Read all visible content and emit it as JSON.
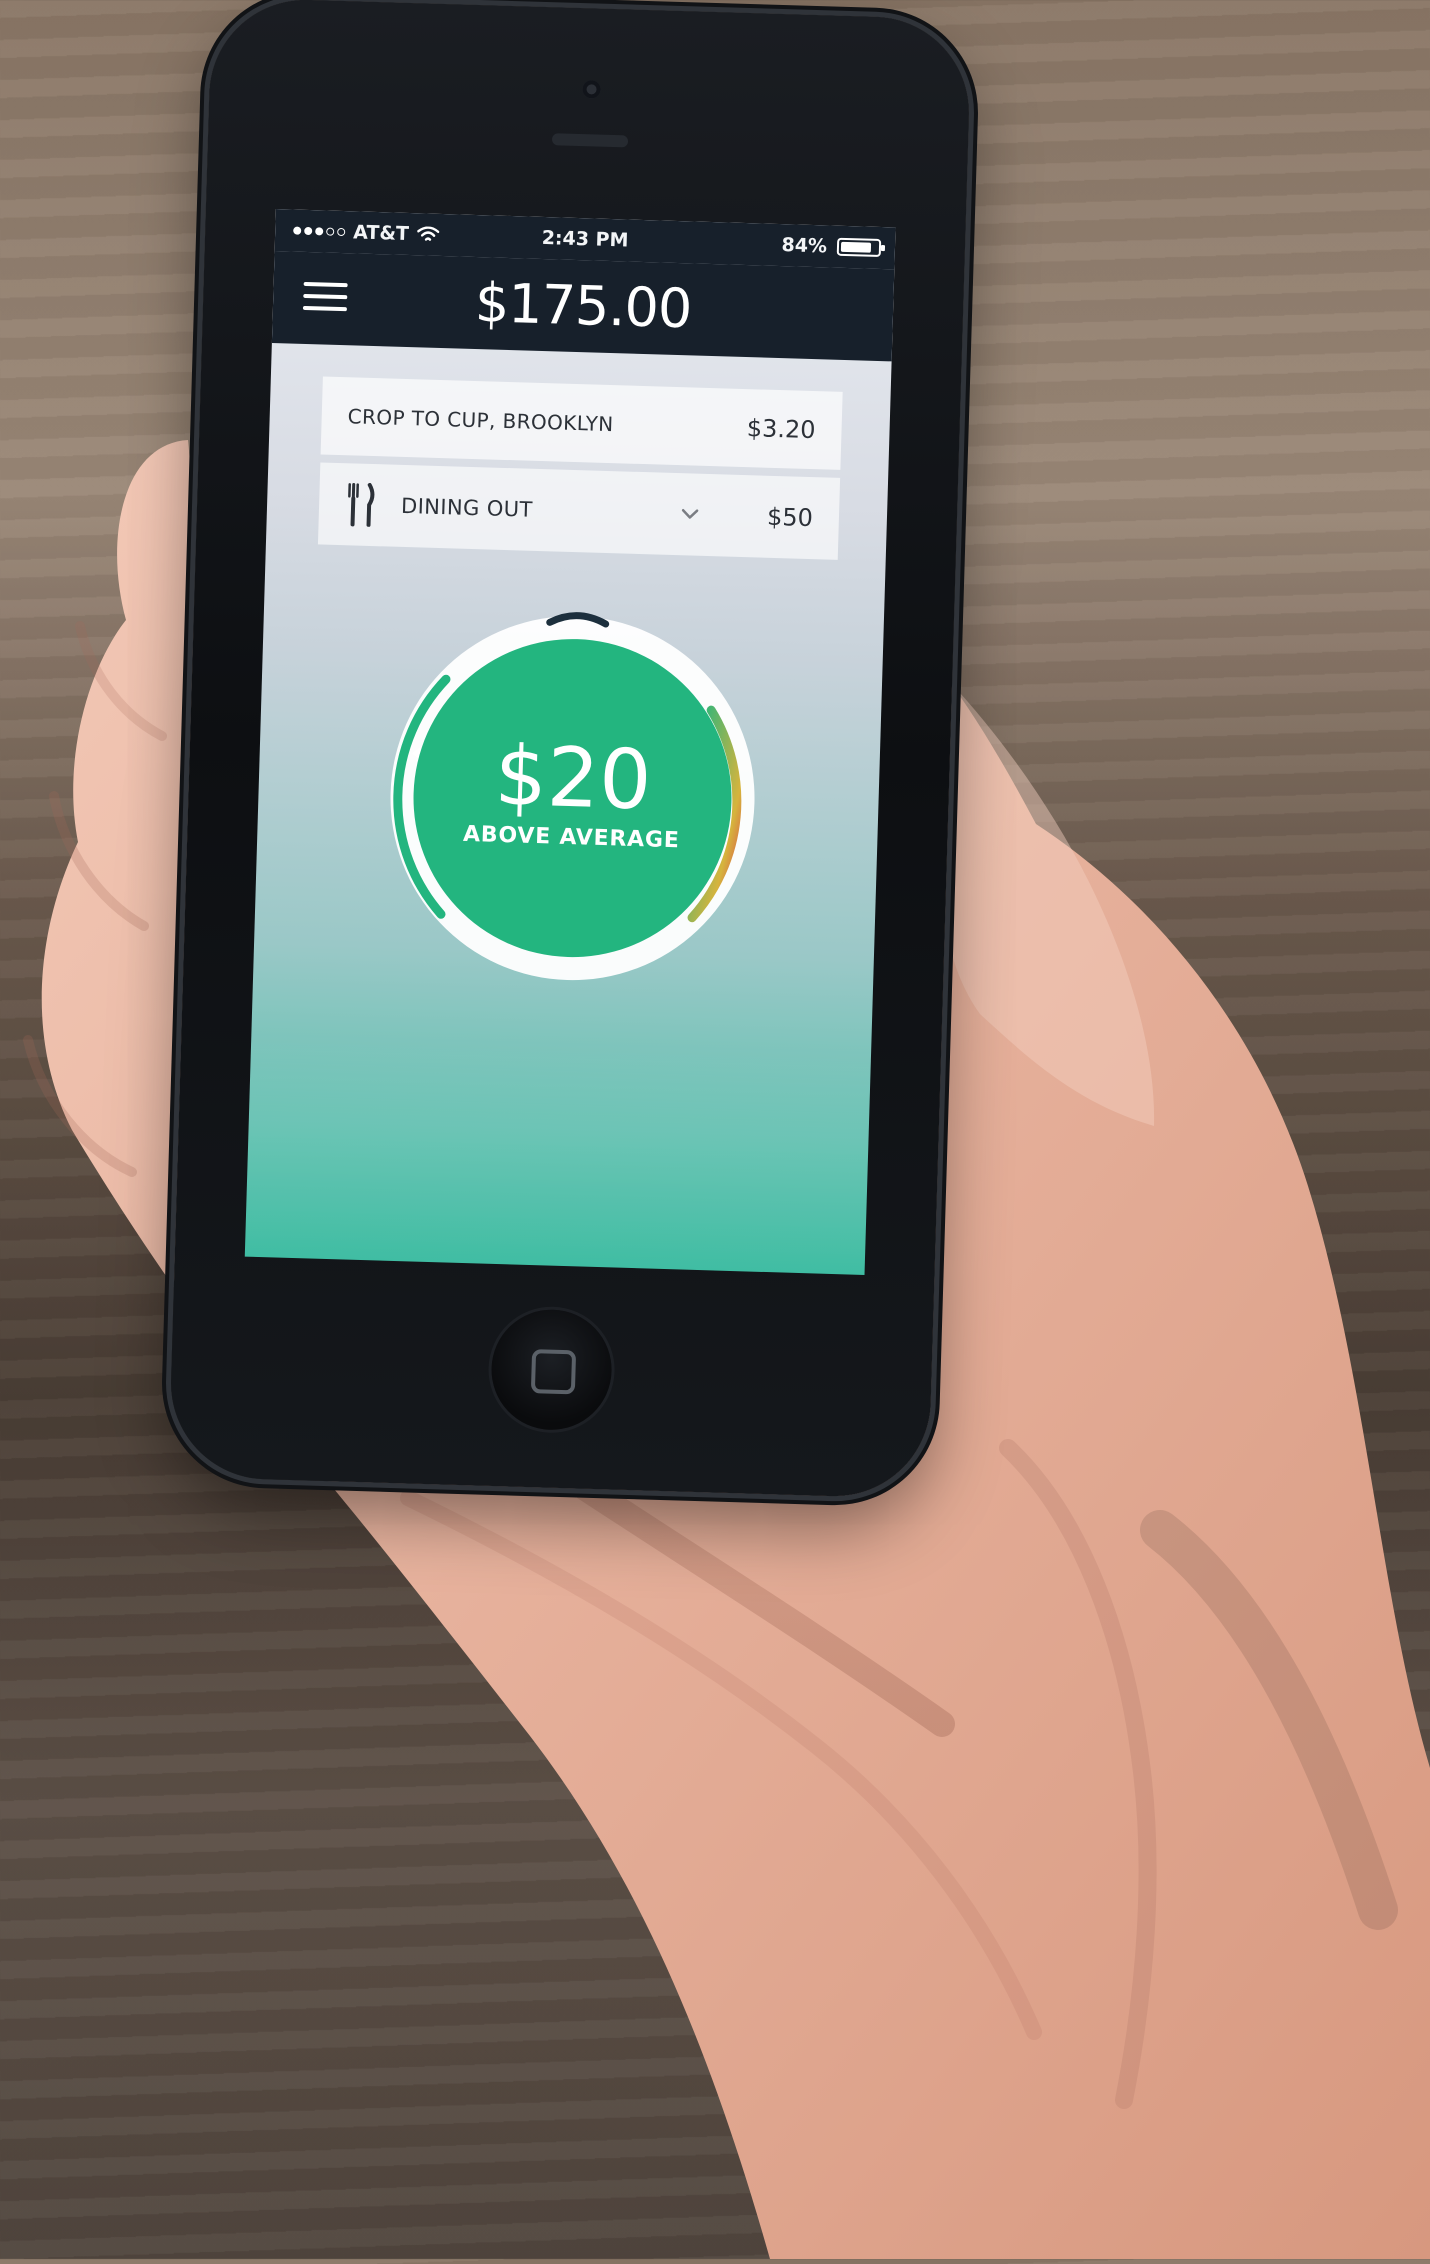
{
  "status_bar": {
    "carrier": "AT&T",
    "time": "2:43 PM",
    "battery_percent": "84%"
  },
  "header": {
    "balance": "$175.00"
  },
  "transaction": {
    "merchant": "CROP TO CUP, BROOKLYN",
    "amount": "$3.20"
  },
  "category": {
    "label": "DINING OUT",
    "amount": "$50"
  },
  "gauge": {
    "value": "$20",
    "label": "ABOVE AVERAGE"
  },
  "icons": {
    "menu": "menu-icon",
    "wifi": "wifi-icon",
    "battery": "battery-icon",
    "category": "fork-knife-icon",
    "dropdown": "chevron-down-icon",
    "home": "home-button-icon"
  },
  "colors": {
    "header_bg": "#17202b",
    "gauge_green": "#23b57f",
    "gauge_yellow": "#d6b43d",
    "gauge_red": "#d94b4b"
  }
}
